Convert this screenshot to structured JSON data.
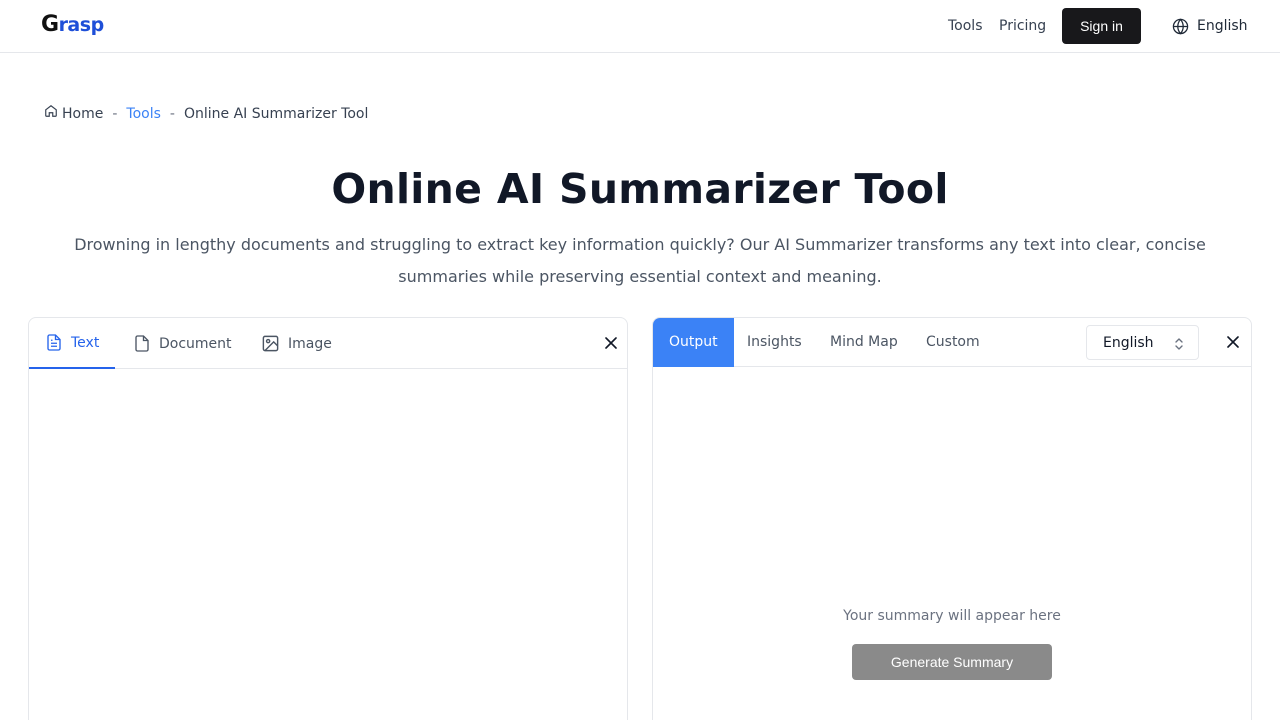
{
  "header": {
    "logo_first": "G",
    "logo_rest": "rasp",
    "nav": [
      {
        "label": "Tools"
      },
      {
        "label": "Pricing"
      }
    ],
    "signin_label": "Sign in",
    "language_label": "English"
  },
  "breadcrumb": {
    "home": "Home",
    "tools": "Tools",
    "current": "Online AI Summarizer Tool",
    "separator": "-"
  },
  "hero": {
    "title": "Online AI Summarizer Tool",
    "subtitle": "Drowning in lengthy documents and struggling to extract key information quickly? Our AI Summarizer transforms any text into clear, concise summaries while preserving essential context and meaning."
  },
  "input_panel": {
    "tabs": [
      {
        "label": "Text",
        "icon": "file-text-icon",
        "active": true
      },
      {
        "label": "Document",
        "icon": "file-icon",
        "active": false
      },
      {
        "label": "Image",
        "icon": "image-icon",
        "active": false
      }
    ],
    "text_value": ""
  },
  "output_panel": {
    "tabs": [
      {
        "label": "Output",
        "active": true
      },
      {
        "label": "Insights",
        "active": false
      },
      {
        "label": "Mind Map",
        "active": false
      },
      {
        "label": "Custom",
        "active": false
      }
    ],
    "language_value": "English",
    "empty_message": "Your summary will appear here",
    "generate_label": "Generate Summary"
  },
  "colors": {
    "accent": "#3b82f6",
    "primary_button": "#18181b",
    "disabled_button": "#8a8a8a",
    "logo_blue": "#1e4fd8"
  }
}
